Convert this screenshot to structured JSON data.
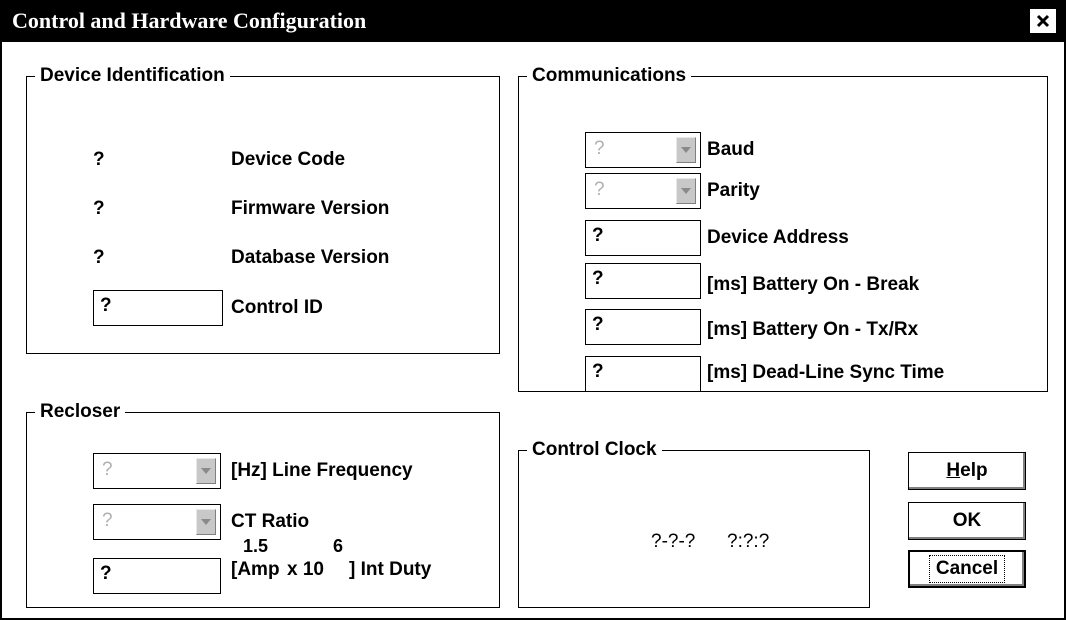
{
  "window": {
    "title": "Control and Hardware Configuration",
    "close_glyph": "×"
  },
  "device_identification": {
    "legend": "Device Identification",
    "device_code": {
      "value": "?",
      "label": "Device Code"
    },
    "firmware_version": {
      "value": "?",
      "label": "Firmware Version"
    },
    "database_version": {
      "value": "?",
      "label": "Database Version"
    },
    "control_id": {
      "value": "?",
      "label": "Control ID"
    }
  },
  "communications": {
    "legend": "Communications",
    "baud": {
      "value": "?",
      "label": "Baud"
    },
    "parity": {
      "value": "?",
      "label": "Parity"
    },
    "device_address": {
      "value": "?",
      "label": "Device Address"
    },
    "battery_on_break": {
      "value": "?",
      "label": "[ms] Battery On - Break"
    },
    "battery_on_txrx": {
      "value": "?",
      "label": "[ms] Battery On - Tx/Rx"
    },
    "dead_line_sync": {
      "value": "?",
      "label": "[ms] Dead-Line Sync Time"
    }
  },
  "recloser": {
    "legend": "Recloser",
    "line_frequency": {
      "value": "?",
      "label": "[Hz] Line Frequency"
    },
    "ct_ratio": {
      "value": "?",
      "label": "CT Ratio"
    },
    "int_duty": {
      "value": "?",
      "exp1": "1.5",
      "exp2": "6",
      "label_part1": "[Amp",
      "label_part2": "x 10",
      "label_part3": "] Int Duty"
    }
  },
  "control_clock": {
    "legend": "Control Clock",
    "date": "?-?-?",
    "time": "?:?:?"
  },
  "buttons": {
    "help": {
      "mnemonic": "H",
      "rest": "elp"
    },
    "ok": "OK",
    "cancel": "Cancel"
  }
}
